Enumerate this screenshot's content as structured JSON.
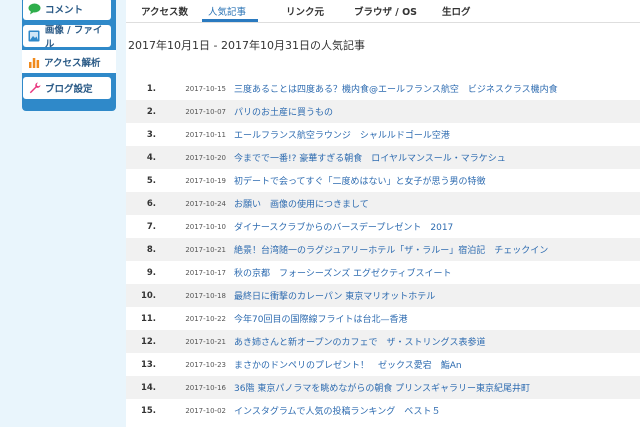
{
  "sidebar": {
    "items": [
      {
        "label": "コメント",
        "icon": "speech-bubble-icon",
        "color": "#2fae4b"
      },
      {
        "label": "画像 / ファイル",
        "icon": "image-icon",
        "color": "#2f89c9"
      },
      {
        "label": "アクセス解析",
        "icon": "bar-chart-icon",
        "color": "#f08a1c"
      },
      {
        "label": "ブログ設定",
        "icon": "wrench-icon",
        "color": "#e8357d"
      }
    ]
  },
  "tabs": [
    {
      "label": "アクセス数"
    },
    {
      "label": "人気記事"
    },
    {
      "label": "リンク元"
    },
    {
      "label": "ブラウザ / OS"
    },
    {
      "label": "生ログ"
    }
  ],
  "title": "2017年10月1日 - 2017年10月31日の人気記事",
  "ranking": [
    {
      "rank": "1.",
      "date": "2017-10-15",
      "title": "三度あることは四度ある？機内食@エールフランス航空　ビジネスクラス機内食"
    },
    {
      "rank": "2.",
      "date": "2017-10-07",
      "title": "パリのお土産に買うもの"
    },
    {
      "rank": "3.",
      "date": "2017-10-11",
      "title": "エールフランス航空ラウンジ　シャルルドゴール空港"
    },
    {
      "rank": "4.",
      "date": "2017-10-20",
      "title": "今までで一番!? 豪華すぎる朝食　ロイヤルマンスール・マラケシュ"
    },
    {
      "rank": "5.",
      "date": "2017-10-19",
      "title": "初デートで会ってすぐ「二度めはない」と女子が思う男の特徴"
    },
    {
      "rank": "6.",
      "date": "2017-10-24",
      "title": "お願い　画像の使用につきまして"
    },
    {
      "rank": "7.",
      "date": "2017-10-10",
      "title": "ダイナースクラブからのバースデープレゼント　2017"
    },
    {
      "rank": "8.",
      "date": "2017-10-21",
      "title": "絶景！台湾随一のラグジュアリーホテル「ザ・ラルー」宿泊記　チェックイン"
    },
    {
      "rank": "9.",
      "date": "2017-10-17",
      "title": "秋の京都　フォーシーズンズ エグゼクティブスイート"
    },
    {
      "rank": "10.",
      "date": "2017-10-18",
      "title": "最終日に衝撃のカレーパン 東京マリオットホテル"
    },
    {
      "rank": "11.",
      "date": "2017-10-22",
      "title": "今年70回目の国際線フライトは台北—香港"
    },
    {
      "rank": "12.",
      "date": "2017-10-21",
      "title": "あき姉さんと新オープンのカフェで　ザ・ストリングス表参道"
    },
    {
      "rank": "13.",
      "date": "2017-10-23",
      "title": "まさかのドンペリのプレゼント！　ゼックス愛宕　鮨An"
    },
    {
      "rank": "14.",
      "date": "2017-10-16",
      "title": "36階 東京パノラマを眺めながらの朝食 プリンスギャラリー東京紀尾井町"
    },
    {
      "rank": "15.",
      "date": "2017-10-02",
      "title": "インスタグラムで人気の投稿ランキング　ベスト５"
    }
  ]
}
